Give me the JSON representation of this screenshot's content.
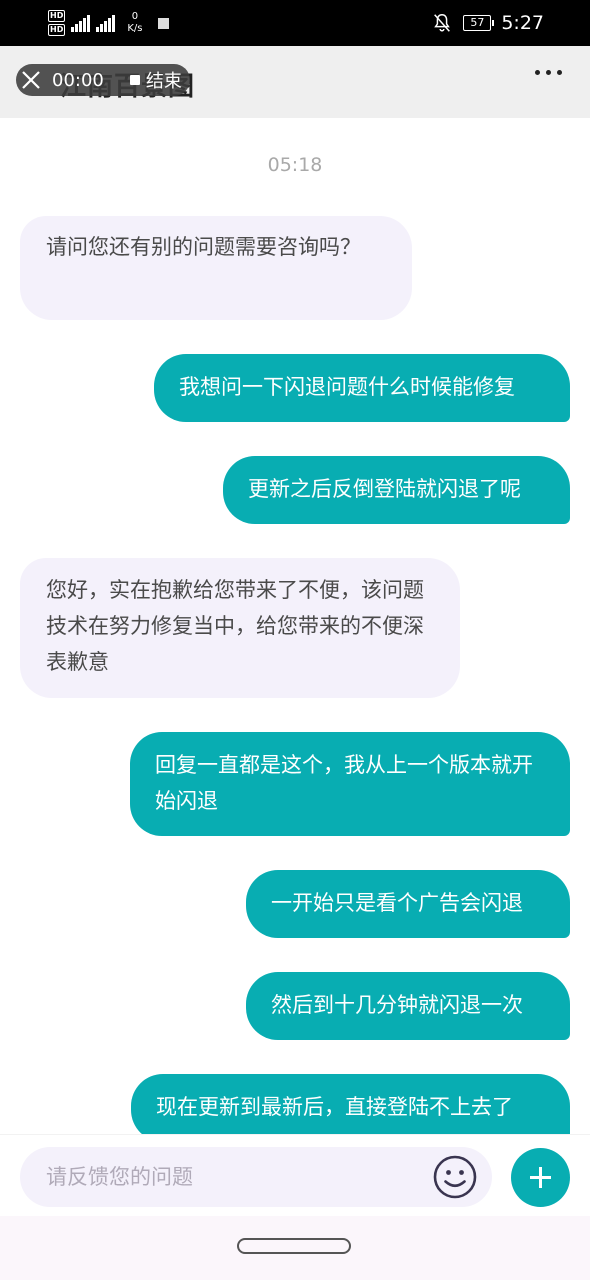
{
  "status_bar": {
    "hd1": "HD",
    "hd2": "HD",
    "signal1": "4G",
    "signal2": "4G",
    "net_speed_value": "0",
    "net_speed_unit": "K/s",
    "battery": "57",
    "time": "5:27"
  },
  "header": {
    "title": "江南百景图",
    "recording": {
      "time": "00:00",
      "end_label": "结束"
    }
  },
  "chat": {
    "timestamp": "05:18",
    "messages": [
      {
        "from": "agent",
        "text": "请问您还有别的问题需要咨询吗？"
      },
      {
        "from": "user",
        "text": "我想问一下闪退问题什么时候能修复"
      },
      {
        "from": "user",
        "text": "更新之后反倒登陆就闪退了呢"
      },
      {
        "from": "agent",
        "text": "您好，实在抱歉给您带来了不便，该问题技术在努力修复当中，给您带来的不便深表歉意"
      },
      {
        "from": "user",
        "text": "回复一直都是这个，我从上一个版本就开始闪退"
      },
      {
        "from": "user",
        "text": "一开始只是看个广告会闪退"
      },
      {
        "from": "user",
        "text": "然后到十几分钟就闪退一次"
      },
      {
        "from": "user",
        "text": "现在更新到最新后，直接登陆不上去了"
      }
    ]
  },
  "input": {
    "placeholder": "请反馈您的问题"
  },
  "colors": {
    "accent": "#08adb2",
    "incoming_bubble": "#f4f1fb"
  }
}
